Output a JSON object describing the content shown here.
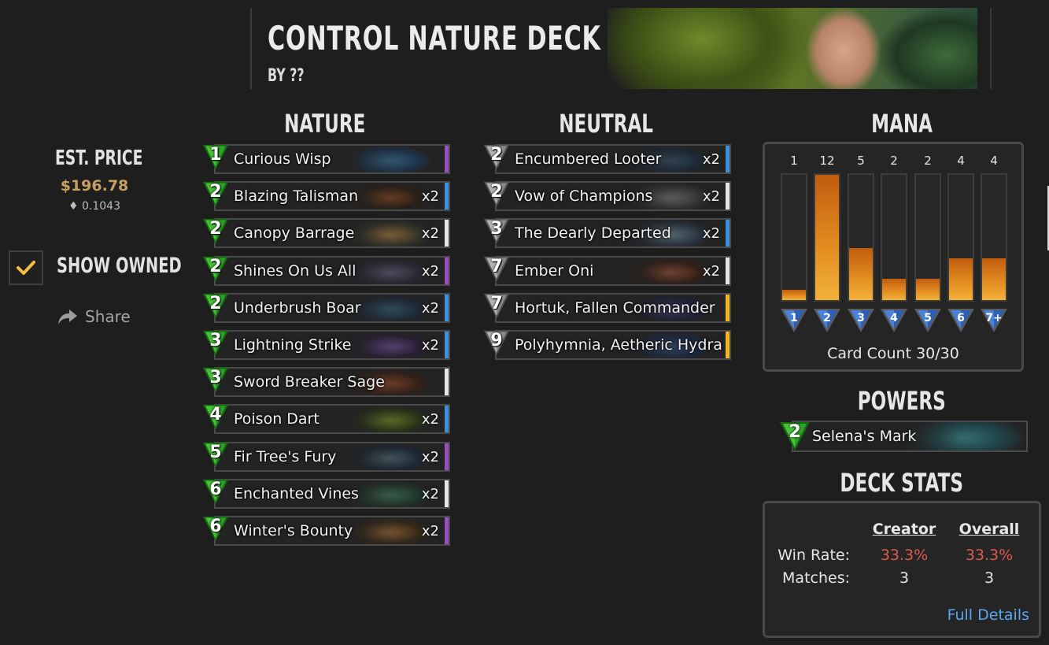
{
  "deck": {
    "title": "CONTROL NATURE DECK",
    "author": "BY ??"
  },
  "price": {
    "label": "EST. PRICE",
    "usd": "$196.78",
    "eth": "0.1043"
  },
  "owned": {
    "label": "SHOW OWNED",
    "checked": true
  },
  "share": {
    "label": "Share"
  },
  "sections": {
    "nature": "NATURE",
    "neutral": "NEUTRAL",
    "mana": "MANA",
    "powers": "POWERS",
    "deck_stats": "DECK STATS"
  },
  "colors": {
    "nature_gem": "#2fa32a",
    "neutral_gem": "#9a9a9a",
    "mana_bar": "#e38f22",
    "win_rate": "#e05a4f",
    "link": "#5aa6f0",
    "price": "#c8a060",
    "rarity_common": "#e6e6e6",
    "rarity_rare": "#3d8fe0",
    "rarity_epic": "#9a4fc0",
    "rarity_legendary": "#f0b520"
  },
  "nature_cards": [
    {
      "cost": "1",
      "name": "Curious Wisp",
      "qty": "",
      "rarity": "epic",
      "art": [
        "#1a3a5a",
        "#3e7fae"
      ]
    },
    {
      "cost": "2",
      "name": "Blazing Talisman",
      "qty": "x2",
      "rarity": "rare",
      "art": [
        "#2a1e12",
        "#9a4f1e"
      ]
    },
    {
      "cost": "2",
      "name": "Canopy Barrage",
      "qty": "x2",
      "rarity": "common",
      "art": [
        "#3a3a2a",
        "#c08a4a"
      ]
    },
    {
      "cost": "2",
      "name": "Shines On Us All",
      "qty": "x2",
      "rarity": "epic",
      "art": [
        "#2a2a3a",
        "#6a6a8a"
      ]
    },
    {
      "cost": "2",
      "name": "Underbrush Boar",
      "qty": "x2",
      "rarity": "rare",
      "art": [
        "#1a2a3a",
        "#3a6a8a"
      ]
    },
    {
      "cost": "3",
      "name": "Lightning Strike",
      "qty": "x2",
      "rarity": "rare",
      "art": [
        "#2a1e3a",
        "#7a5aaa"
      ]
    },
    {
      "cost": "3",
      "name": "Sword Breaker Sage",
      "qty": "",
      "rarity": "common",
      "art": [
        "#3a1e12",
        "#a8502a"
      ]
    },
    {
      "cost": "4",
      "name": "Poison Dart",
      "qty": "x2",
      "rarity": "rare",
      "art": [
        "#2a3a12",
        "#8aa02a"
      ]
    },
    {
      "cost": "5",
      "name": "Fir Tree's Fury",
      "qty": "x2",
      "rarity": "epic",
      "art": [
        "#1a2a3a",
        "#5a7a8a"
      ]
    },
    {
      "cost": "6",
      "name": "Enchanted Vines",
      "qty": "x2",
      "rarity": "common",
      "art": [
        "#1e3a2a",
        "#4a8a6a"
      ]
    },
    {
      "cost": "6",
      "name": "Winter's Bounty",
      "qty": "x2",
      "rarity": "epic",
      "art": [
        "#3a2a12",
        "#b87a3a"
      ]
    }
  ],
  "neutral_cards": [
    {
      "cost": "2",
      "name": "Encumbered Looter",
      "qty": "x2",
      "rarity": "rare",
      "art": [
        "#1a2a3a",
        "#3a5a7a"
      ]
    },
    {
      "cost": "2",
      "name": "Vow of Champions",
      "qty": "x2",
      "rarity": "common",
      "art": [
        "#3a3a3a",
        "#8a8a8a"
      ]
    },
    {
      "cost": "3",
      "name": "The Dearly Departed",
      "qty": "x2",
      "rarity": "rare",
      "art": [
        "#2a3a4a",
        "#7a9aaa"
      ]
    },
    {
      "cost": "7",
      "name": "Ember Oni",
      "qty": "x2",
      "rarity": "common",
      "art": [
        "#3a1e12",
        "#a85a3a"
      ]
    },
    {
      "cost": "7",
      "name": "Hortuk, Fallen Commander",
      "qty": "",
      "rarity": "legendary",
      "art": [
        "#1e1e3a",
        "#4a4a8a"
      ]
    },
    {
      "cost": "9",
      "name": "Polyhymnia, Aetheric Hydra",
      "qty": "",
      "rarity": "legendary",
      "art": [
        "#1a2a4a",
        "#3a5a8a"
      ]
    }
  ],
  "mana": {
    "max": 12,
    "columns": [
      {
        "label": "1",
        "count": 1
      },
      {
        "label": "2",
        "count": 12
      },
      {
        "label": "3",
        "count": 5
      },
      {
        "label": "4",
        "count": 2
      },
      {
        "label": "5",
        "count": 2
      },
      {
        "label": "6",
        "count": 4
      },
      {
        "label": "7+",
        "count": 4
      }
    ],
    "card_count": "Card Count 30/30"
  },
  "power": {
    "cost": "2",
    "name": "Selena's Mark"
  },
  "stats": {
    "col_creator": "Creator",
    "col_overall": "Overall",
    "win_label": "Win Rate:",
    "matches_label": "Matches:",
    "creator_win": "33.3%",
    "overall_win": "33.3%",
    "creator_matches": "3",
    "overall_matches": "3",
    "full_details": "Full Details"
  }
}
